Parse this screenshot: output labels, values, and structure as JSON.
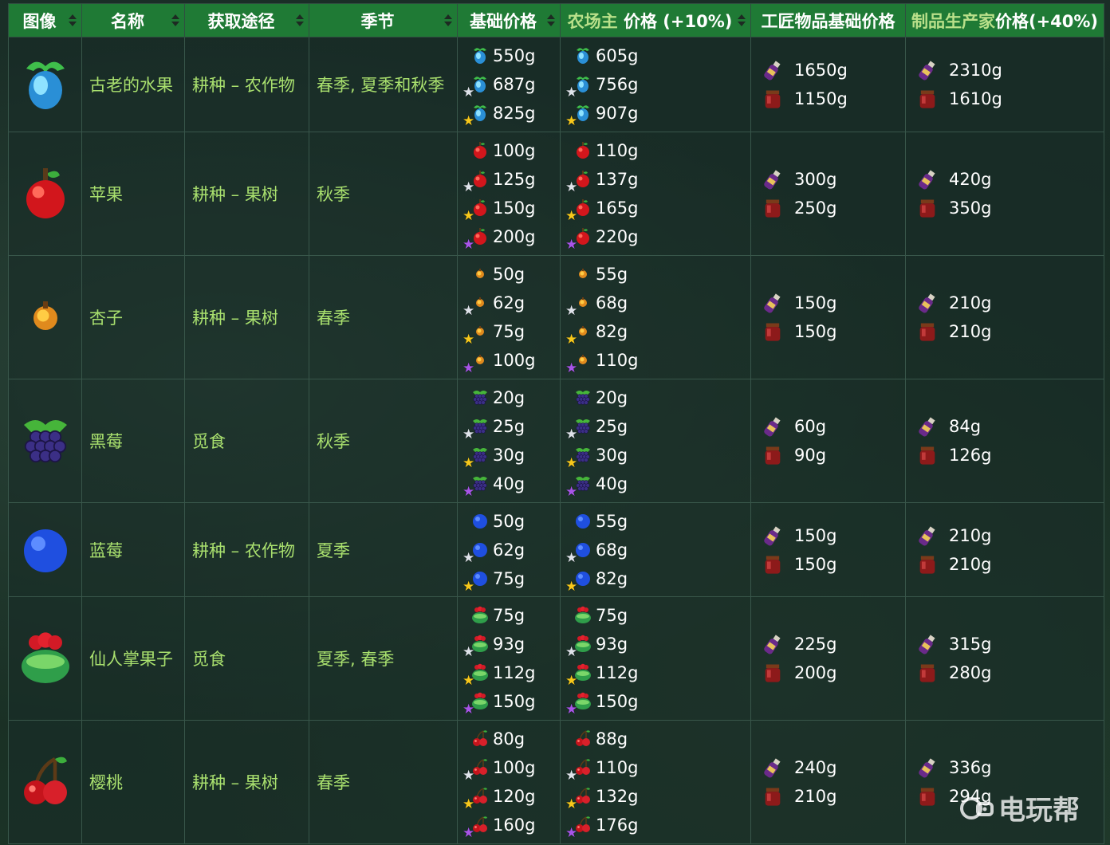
{
  "headers": [
    {
      "label": "图像",
      "highlight": false
    },
    {
      "label": "名称",
      "highlight": false
    },
    {
      "label": "获取途径",
      "highlight": false
    },
    {
      "label": "季节",
      "highlight": false
    },
    {
      "label": "基础价格",
      "highlight": false
    },
    {
      "label_a": "农场主",
      "label_b": " 价格 (+10%)",
      "highlight": true
    },
    {
      "label": "工匠物品基础价格",
      "highlight": false
    },
    {
      "label_a": "制品生产家",
      "label_b": "价格(+40%)",
      "highlight": true
    }
  ],
  "rows": [
    {
      "name": "古老的水果",
      "source": "耕种 – 农作物",
      "season": "春季, 夏季和秋季",
      "fruit": "ancient-fruit",
      "base": [
        "550g",
        "687g",
        "825g"
      ],
      "tiller": [
        "605g",
        "756g",
        "907g"
      ],
      "artisan_base": [
        "1650g",
        "1150g"
      ],
      "artisan": [
        "2310g",
        "1610g"
      ]
    },
    {
      "name": "苹果",
      "source": "耕种 – 果树",
      "season": "秋季",
      "fruit": "apple",
      "base": [
        "100g",
        "125g",
        "150g",
        "200g"
      ],
      "tiller": [
        "110g",
        "137g",
        "165g",
        "220g"
      ],
      "artisan_base": [
        "300g",
        "250g"
      ],
      "artisan": [
        "420g",
        "350g"
      ]
    },
    {
      "name": "杏子",
      "source": "耕种 – 果树",
      "season": "春季",
      "fruit": "apricot",
      "base": [
        "50g",
        "62g",
        "75g",
        "100g"
      ],
      "tiller": [
        "55g",
        "68g",
        "82g",
        "110g"
      ],
      "artisan_base": [
        "150g",
        "150g"
      ],
      "artisan": [
        "210g",
        "210g"
      ]
    },
    {
      "name": "黑莓",
      "source": "觅食",
      "season": "秋季",
      "fruit": "blackberry",
      "base": [
        "20g",
        "25g",
        "30g",
        "40g"
      ],
      "tiller": [
        "20g",
        "25g",
        "30g",
        "40g"
      ],
      "artisan_base": [
        "60g",
        "90g"
      ],
      "artisan": [
        "84g",
        "126g"
      ]
    },
    {
      "name": "蓝莓",
      "source": "耕种 – 农作物",
      "season": "夏季",
      "fruit": "blueberry",
      "base": [
        "50g",
        "62g",
        "75g"
      ],
      "tiller": [
        "55g",
        "68g",
        "82g"
      ],
      "artisan_base": [
        "150g",
        "150g"
      ],
      "artisan": [
        "210g",
        "210g"
      ]
    },
    {
      "name": "仙人掌果子",
      "source": "觅食",
      "season": "夏季, 春季",
      "fruit": "cactus-fruit",
      "base": [
        "75g",
        "93g",
        "112g",
        "150g"
      ],
      "tiller": [
        "75g",
        "93g",
        "112g",
        "150g"
      ],
      "artisan_base": [
        "225g",
        "200g"
      ],
      "artisan": [
        "315g",
        "280g"
      ]
    },
    {
      "name": "樱桃",
      "source": "耕种 – 果树",
      "season": "春季",
      "fruit": "cherry",
      "base": [
        "80g",
        "100g",
        "120g",
        "160g"
      ],
      "tiller": [
        "88g",
        "110g",
        "132g",
        "176g"
      ],
      "artisan_base": [
        "240g",
        "210g"
      ],
      "artisan": [
        "336g",
        "294g"
      ]
    }
  ],
  "quality_order": [
    "normal",
    "silver",
    "gold",
    "iridium"
  ],
  "artisan_icons": [
    "wine-icon",
    "jelly-jar-icon"
  ],
  "colors": {
    "header_bg": "#1f7a35",
    "text_green": "#a9e06e",
    "highlight": "#b9e08a"
  },
  "watermark": "电玩帮"
}
